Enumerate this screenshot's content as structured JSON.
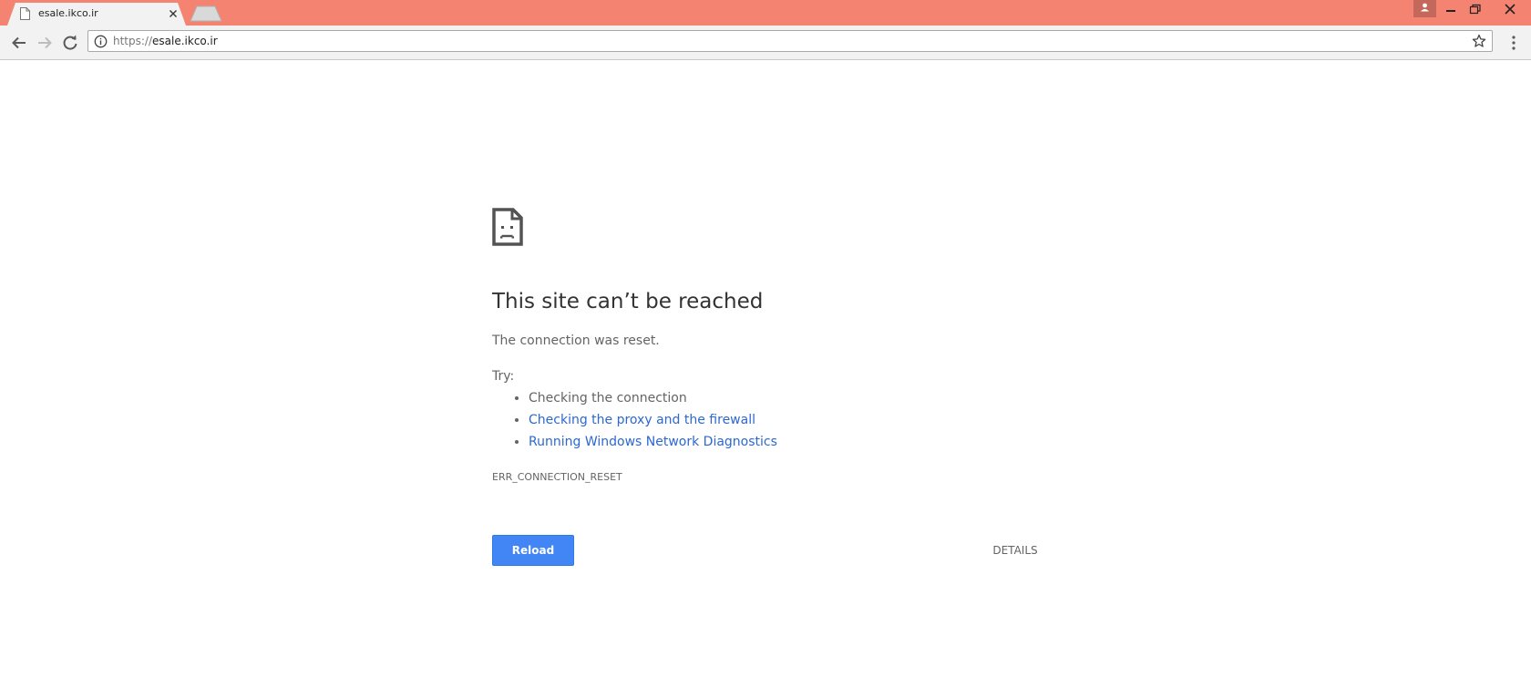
{
  "browser": {
    "tab": {
      "title": "esale.ikco.ir",
      "favicon": "page-icon"
    },
    "address_bar": {
      "scheme": "https://",
      "host": "esale.ikco.ir"
    },
    "colors": {
      "titlebar": "#f58372",
      "tab": "#f2f2f2",
      "toolbar": "#f2f2f2"
    }
  },
  "error_page": {
    "icon": "sad-page-icon",
    "headline": "This site can’t be reached",
    "summary": "The connection was reset.",
    "try_label": "Try:",
    "suggestions": [
      {
        "text": "Checking the connection",
        "is_link": false
      },
      {
        "text": "Checking the proxy and the firewall",
        "is_link": true
      },
      {
        "text": "Running Windows Network Diagnostics",
        "is_link": true
      }
    ],
    "error_code": "ERR_CONNECTION_RESET",
    "buttons": {
      "reload": "Reload",
      "details": "DETAILS"
    },
    "colors": {
      "primary_button": "#4285f4",
      "link": "#2b68d3",
      "text": "#646464"
    }
  }
}
